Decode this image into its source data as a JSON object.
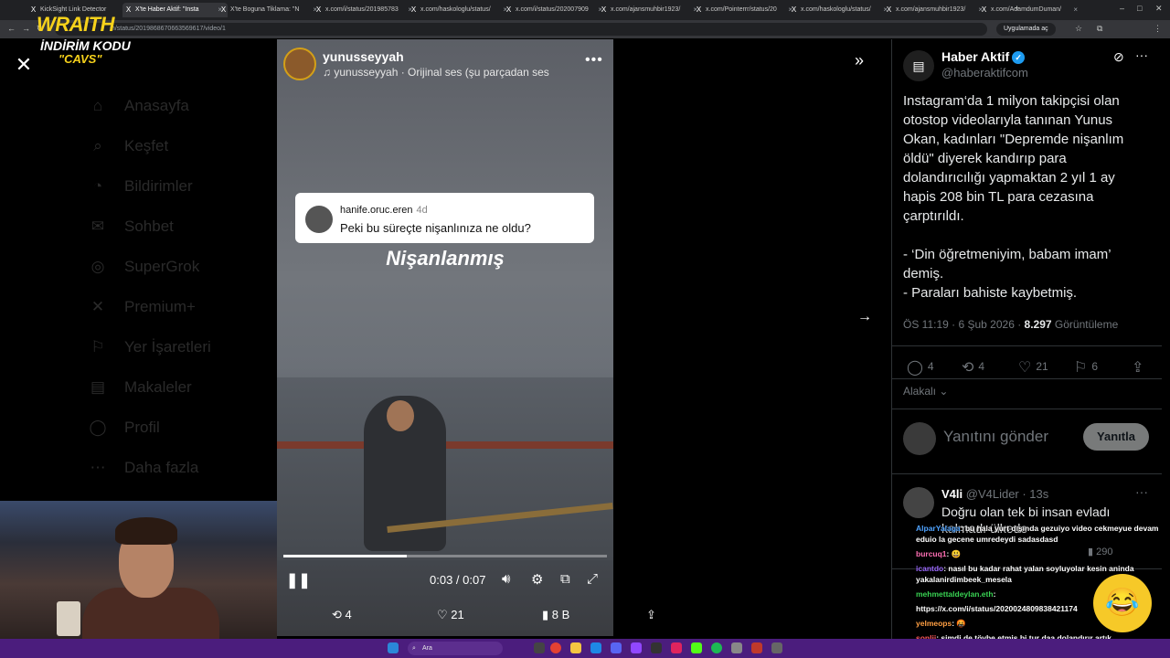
{
  "browser": {
    "tabs": [
      {
        "label": "KickSight Link Detector",
        "active": false
      },
      {
        "label": "X'te Haber Aktif: \"Insta",
        "active": true
      },
      {
        "label": "X'te Boguna Tiklama: \"N",
        "active": false
      },
      {
        "label": "x.com/i/status/201985783",
        "active": false
      },
      {
        "label": "x.com/haskologlu/status/",
        "active": false
      },
      {
        "label": "x.com/i/status/202007909",
        "active": false
      },
      {
        "label": "x.com/ajansmuhbir1923/",
        "active": false
      },
      {
        "label": "x.com/Pointerrr/status/20",
        "active": false
      },
      {
        "label": "x.com/haskologlu/status/",
        "active": false
      },
      {
        "label": "x.com/ajansmuhbir1923/",
        "active": false
      },
      {
        "label": "x.com/AdamdumDuman/",
        "active": false
      }
    ],
    "url": "m/status/2019868670663569617/video/1",
    "app_button": "Uygulamada aç"
  },
  "overlay": {
    "brand_line1": "WRAITH",
    "brand_line2": "İNDİRİM KODU",
    "brand_line3": "\"CAVS\""
  },
  "background_nav": [
    "Anasayfa",
    "Keşfet",
    "Bildirimler",
    "Sohbet",
    "SuperGrok",
    "Premium+",
    "Yer İşaretleri",
    "Makaleler",
    "Profil",
    "Daha fazla"
  ],
  "video": {
    "username": "yunusseyyah",
    "audio": "yunusseyyah · Orijinal ses  (şu parçadan ses",
    "comment_user": "hanife.oruc.eren",
    "comment_age": "4d",
    "comment_text": "Peki bu süreçte nişanlınıza ne oldu?",
    "caption": "Nişanlanmış",
    "time": "0:03 / 0:07",
    "progress": 0.38,
    "retweets": "4",
    "likes": "21",
    "views": "8 B"
  },
  "tweet": {
    "name": "Haber Aktif",
    "handle": "@haberaktifcom",
    "text": "Instagram‘da 1 milyon takipçisi olan otostop videolarıyla tanınan Yunus Okan, kadınları \"Depremde nişanlım öldü\" diyerek kandırıp para dolandırıcılığı yapmaktan 2 yıl 1 ay hapis 208 bin TL para cezasına çarptırıldı.\n\n- ‘Din öğretmeniyim, babam imam’ demiş.\n- Paraları bahiste kaybetmiş.",
    "time": "ÖS 11:19 · 6 Şub 2026 · ",
    "views": "8.297",
    "views_label": " Görüntüleme",
    "replies": "4",
    "retweets": "4",
    "likes": "21",
    "bookmarks": "6",
    "related": "Alakalı",
    "reply_placeholder": "Yanıtını gönder",
    "reply_button": "Yanıtla"
  },
  "reply": {
    "name": "V4li",
    "handle": "@V4Lider · 13s",
    "text": "Doğru olan tek bi insan evladı kalmadı ülkede",
    "views": "290"
  },
  "chat": [
    {
      "user": "AlparYalaga",
      "text": ": bu hala yurt dışında gezuiyo video cekmeyue devam eduio la gecene umredeydi sadasdasd",
      "color": "#4fa3ff"
    },
    {
      "user": "burcuq1",
      "text": ": 😃",
      "color": "#ff6fb4"
    },
    {
      "user": "icantdo",
      "text": ": nasıl bu kadar rahat yalan soyluyolar kesin aninda yakalanirdimbeek_mesela",
      "color": "#9d6bff"
    },
    {
      "user": "mehmettaldeylan.eth",
      "text": ":",
      "color": "#39d353"
    },
    {
      "user": "",
      "text": "https://x.com/i/status/2020024809838421174",
      "color": "#fff"
    },
    {
      "user": "yelmeops",
      "text": ": 🤬",
      "color": "#ff9f43"
    },
    {
      "user": "sonlii",
      "text": ": şimdi de tövbe etmiş bi tur daa dolandırır artık",
      "color": "#ff5a5a"
    }
  ],
  "taskbar": {
    "search": "Ara"
  },
  "colors": {
    "accent": "#1d9bf0",
    "brand_yellow": "#f7d21b",
    "taskbar": "#4b1d7d"
  }
}
